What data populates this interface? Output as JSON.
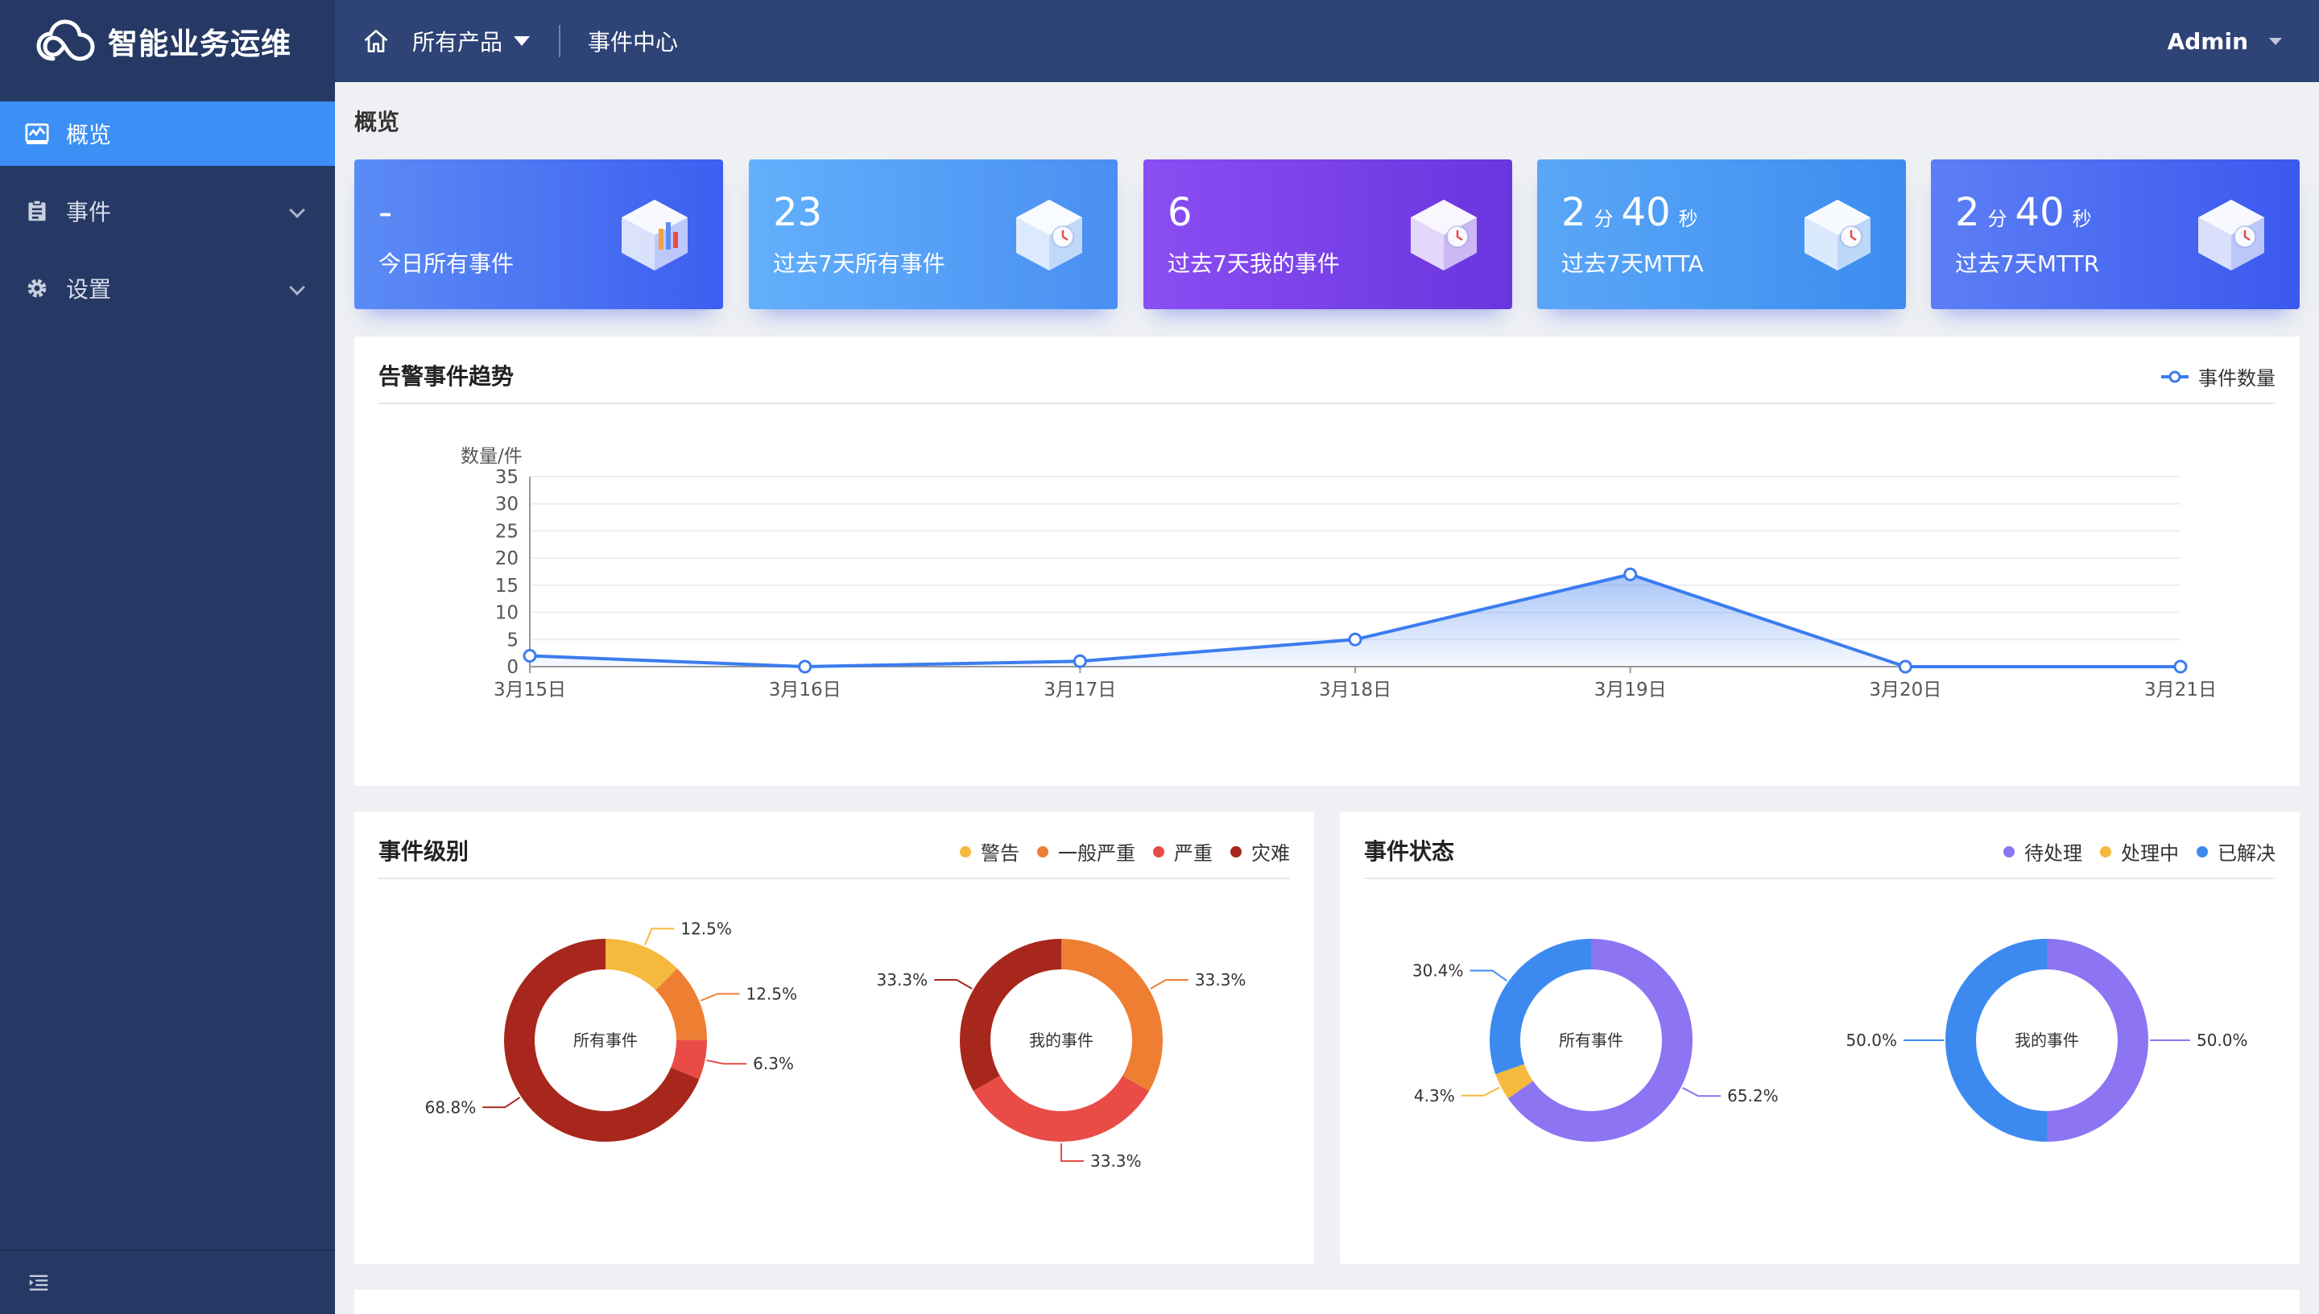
{
  "header": {
    "app_title": "智能业务运维",
    "products_label": "所有产品",
    "events_center_label": "事件中心",
    "user_name": "Admin"
  },
  "sidebar": {
    "items": [
      {
        "label": "概览",
        "icon": "chart-icon",
        "active": true
      },
      {
        "label": "事件",
        "icon": "document-icon",
        "active": false
      },
      {
        "label": "设置",
        "icon": "gear-icon",
        "active": false
      }
    ]
  },
  "page": {
    "title": "概览"
  },
  "stats": [
    {
      "value": "-",
      "label": "今日所有事件",
      "gradient": [
        "#5b8cf5",
        "#3d5ef0"
      ]
    },
    {
      "value": "23",
      "label": "过去7天所有事件",
      "gradient": [
        "#62b0fb",
        "#4a8ff3"
      ]
    },
    {
      "value": "6",
      "label": "过去7天我的事件",
      "gradient": [
        "#8a4ef2",
        "#6a35de"
      ]
    },
    {
      "value_min": "2",
      "unit_min": "分",
      "value_sec": "40",
      "unit_sec": "秒",
      "label": "过去7天MTTA",
      "gradient": [
        "#5aa7f7",
        "#3c8cf0"
      ]
    },
    {
      "value_min": "2",
      "unit_min": "分",
      "value_sec": "40",
      "unit_sec": "秒",
      "label": "过去7天MTTR",
      "gradient": [
        "#5c7ff5",
        "#3b58ee"
      ]
    }
  ],
  "trend": {
    "title": "告警事件趋势",
    "legend": "事件数量"
  },
  "chart_data": [
    {
      "type": "area",
      "title": "告警事件趋势",
      "ylabel": "数量/件",
      "categories": [
        "3月15日",
        "3月16日",
        "3月17日",
        "3月18日",
        "3月19日",
        "3月20日",
        "3月21日"
      ],
      "series": [
        {
          "name": "事件数量",
          "values": [
            2,
            0,
            1,
            5,
            17,
            0,
            0
          ],
          "color": "#3b7cf0"
        }
      ],
      "ylim": [
        0,
        35
      ],
      "yticks": [
        0,
        5,
        10,
        15,
        20,
        25,
        30,
        35
      ],
      "grid": true,
      "legend": "top-right"
    },
    {
      "type": "pie",
      "title": "事件级别",
      "center_label": "所有事件",
      "slices": [
        {
          "name": "警告",
          "value": 12.5,
          "label": "12.5%",
          "color": "#f5b93d"
        },
        {
          "name": "一般严重",
          "value": 12.5,
          "label": "12.5%",
          "color": "#ee7f32"
        },
        {
          "name": "严重",
          "value": 6.3,
          "label": "6.3%",
          "color": "#e94b47"
        },
        {
          "name": "灾难",
          "value": 68.8,
          "label": "68.8%",
          "color": "#a7271c"
        }
      ]
    },
    {
      "type": "pie",
      "title": "事件级别",
      "center_label": "我的事件",
      "slices": [
        {
          "name": "一般严重",
          "value": 33.3,
          "label": "33.3%",
          "color": "#ee7f32"
        },
        {
          "name": "严重",
          "value": 33.3,
          "label": "33.3%",
          "color": "#e94b47"
        },
        {
          "name": "灾难",
          "value": 33.3,
          "label": "33.3%",
          "color": "#a7271c"
        }
      ]
    },
    {
      "type": "pie",
      "title": "事件状态",
      "center_label": "所有事件",
      "slices": [
        {
          "name": "待处理",
          "value": 65.2,
          "label": "65.2%",
          "color": "#8c74f3"
        },
        {
          "name": "处理中",
          "value": 4.3,
          "label": "4.3%",
          "color": "#f5b93d"
        },
        {
          "name": "已解决",
          "value": 30.4,
          "label": "30.4%",
          "color": "#3c8af0"
        }
      ]
    },
    {
      "type": "pie",
      "title": "事件状态",
      "center_label": "我的事件",
      "slices": [
        {
          "name": "待处理",
          "value": 50.0,
          "label": "50.0%",
          "color": "#8c74f3"
        },
        {
          "name": "已解决",
          "value": 50.0,
          "label": "50.0%",
          "color": "#3c8af0"
        }
      ]
    }
  ],
  "level_panel": {
    "title": "事件级别",
    "legend": [
      {
        "name": "警告",
        "color": "#f5b93d"
      },
      {
        "name": "一般严重",
        "color": "#ee7f32"
      },
      {
        "name": "严重",
        "color": "#e94b47"
      },
      {
        "name": "灾难",
        "color": "#a7271c"
      }
    ]
  },
  "status_panel": {
    "title": "事件状态",
    "legend": [
      {
        "name": "待处理",
        "color": "#8c74f3"
      },
      {
        "name": "处理中",
        "color": "#f5b93d"
      },
      {
        "name": "已解决",
        "color": "#3c8af0"
      }
    ]
  }
}
